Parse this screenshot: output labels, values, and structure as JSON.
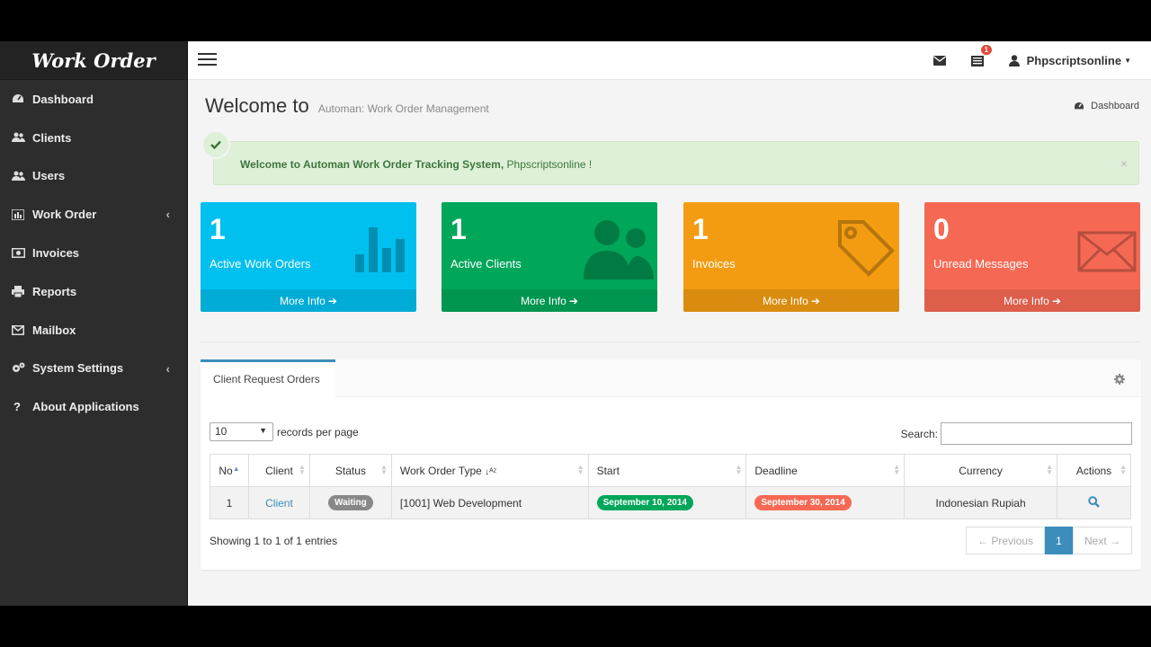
{
  "brand": "Work Order",
  "sidebar": {
    "items": [
      {
        "label": "Dashboard",
        "icon": "dashboard-icon"
      },
      {
        "label": "Clients",
        "icon": "users-icon"
      },
      {
        "label": "Users",
        "icon": "users-icon"
      },
      {
        "label": "Work Order",
        "icon": "bar-chart-icon"
      },
      {
        "label": "Invoices",
        "icon": "money-icon"
      },
      {
        "label": "Reports",
        "icon": "print-icon"
      },
      {
        "label": "Mailbox",
        "icon": "envelope-icon"
      },
      {
        "label": "System Settings",
        "icon": "gears-icon"
      },
      {
        "label": "About Applications",
        "icon": "question-icon"
      }
    ]
  },
  "topnav": {
    "notification_count": "1",
    "user_name": "Phpscriptsonline"
  },
  "header": {
    "title": "Welcome to",
    "subtitle": "Automan: Work Order Management",
    "breadcrumb": "Dashboard"
  },
  "alert": {
    "strong_text": "Welcome to Automan Work Order Tracking System,",
    "text": " Phpscriptsonline !",
    "close": "×"
  },
  "boxes": [
    {
      "value": "1",
      "label": "Active Work Orders",
      "more": "More Info",
      "color": "#00c0ef"
    },
    {
      "value": "1",
      "label": "Active Clients",
      "more": "More Info",
      "color": "#00a65a"
    },
    {
      "value": "1",
      "label": "Invoices",
      "more": "More Info",
      "color": "#f39c12"
    },
    {
      "value": "0",
      "label": "Unread Messages",
      "more": "More Info",
      "color": "#f56954"
    }
  ],
  "panel": {
    "tab": "Client Request Orders",
    "length_value": "10",
    "length_suffix": "records per page",
    "search_label": "Search:",
    "columns": [
      "No",
      "Client",
      "Status",
      "Work Order Type",
      "Start",
      "Deadline",
      "Currency",
      "Actions"
    ],
    "rows": [
      {
        "no": "1",
        "client": "Client",
        "status": "Waiting",
        "type": "[1001] Web Development",
        "start": "September 10, 2014",
        "deadline": "September 30, 2014",
        "currency": "Indonesian Rupiah"
      }
    ],
    "info": "Showing 1 to 1 of 1 entries",
    "pager": {
      "prev": "← Previous",
      "current": "1",
      "next": "Next →"
    }
  }
}
